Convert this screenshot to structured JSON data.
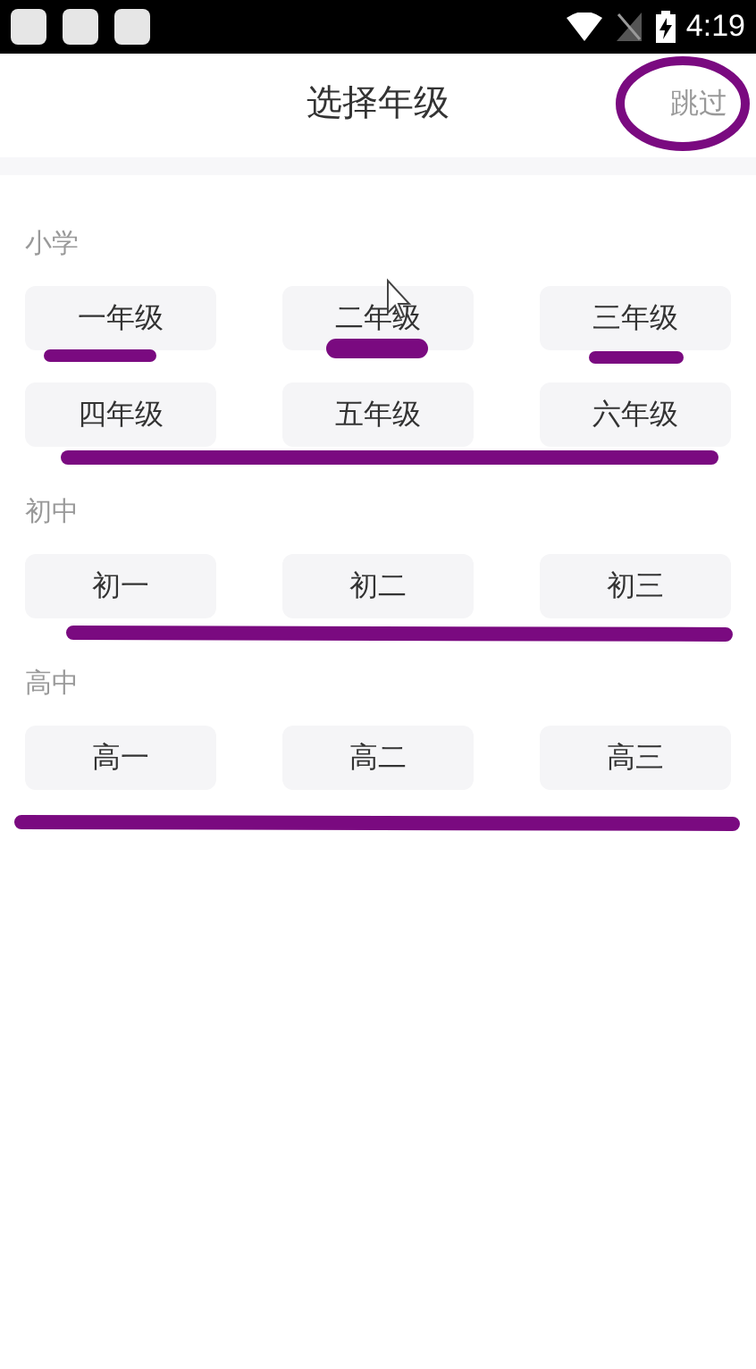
{
  "status_bar": {
    "time": "4:19"
  },
  "header": {
    "title": "选择年级",
    "skip": "跳过"
  },
  "sections": [
    {
      "label": "小学",
      "grades": [
        "一年级",
        "二年级",
        "三年级",
        "四年级",
        "五年级",
        "六年级"
      ]
    },
    {
      "label": "初中",
      "grades": [
        "初一",
        "初二",
        "初三"
      ]
    },
    {
      "label": "高中",
      "grades": [
        "高一",
        "高二",
        "高三"
      ]
    }
  ]
}
